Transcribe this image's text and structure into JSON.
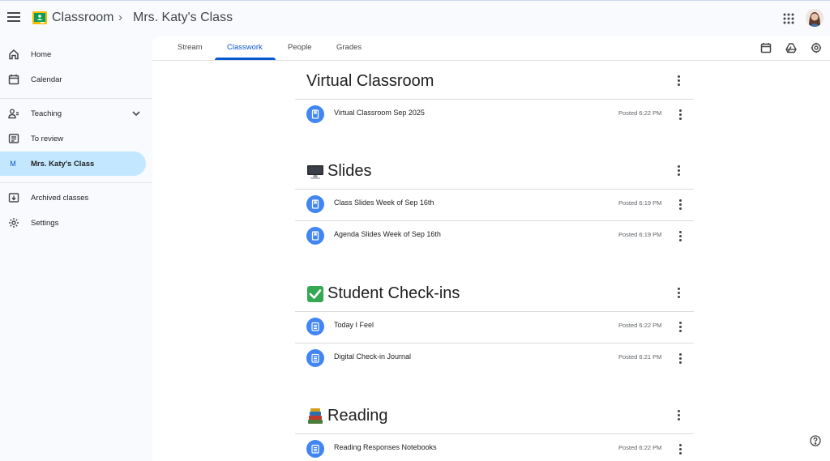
{
  "header": {
    "app_title": "Classroom",
    "breadcrumb_sep": "›",
    "class_title": "Mrs. Katy's Class"
  },
  "sidebar": {
    "items": [
      {
        "label": "Home",
        "icon": "home-icon"
      },
      {
        "label": "Calendar",
        "icon": "calendar-icon"
      },
      {
        "label": "Teaching",
        "icon": "teaching-icon"
      },
      {
        "label": "To review",
        "icon": "to-review-icon"
      },
      {
        "label": "Mrs. Katy's Class",
        "icon": "class-letter-icon",
        "letter": "M"
      },
      {
        "label": "Archived classes",
        "icon": "archive-icon"
      },
      {
        "label": "Settings",
        "icon": "gear-icon"
      }
    ]
  },
  "tabs": [
    {
      "label": "Stream"
    },
    {
      "label": "Classwork",
      "active": true
    },
    {
      "label": "People"
    },
    {
      "label": "Grades"
    }
  ],
  "topics": [
    {
      "title": "Virtual Classroom",
      "emoji": "",
      "items": [
        {
          "title": "Virtual Classroom Sep 2025",
          "posted": "Posted 6:22 PM",
          "type": "material"
        }
      ]
    },
    {
      "title": "Slides",
      "emoji": "desktop-computer-icon",
      "items": [
        {
          "title": "Class Slides Week of Sep 16th",
          "posted": "Posted 6:19 PM",
          "type": "material"
        },
        {
          "title": "Agenda Slides Week of Sep 16th",
          "posted": "Posted 6:19 PM",
          "type": "material"
        }
      ]
    },
    {
      "title": "Student Check-ins",
      "emoji": "check-mark-button-icon",
      "items": [
        {
          "title": "Today I Feel",
          "posted": "Posted 6:22 PM",
          "type": "assignment"
        },
        {
          "title": "Digital Check-in Journal",
          "posted": "Posted 6:21 PM",
          "type": "assignment"
        }
      ]
    },
    {
      "title": "Reading",
      "emoji": "books-icon",
      "items": [
        {
          "title": "Reading Responses Notebooks",
          "posted": "Posted 6:22 PM",
          "type": "assignment"
        }
      ]
    }
  ],
  "colors": {
    "accent": "#0b57d0",
    "active_nav": "#c2e7ff",
    "item_icon": "#4285f4",
    "background": "#f8fafd"
  }
}
